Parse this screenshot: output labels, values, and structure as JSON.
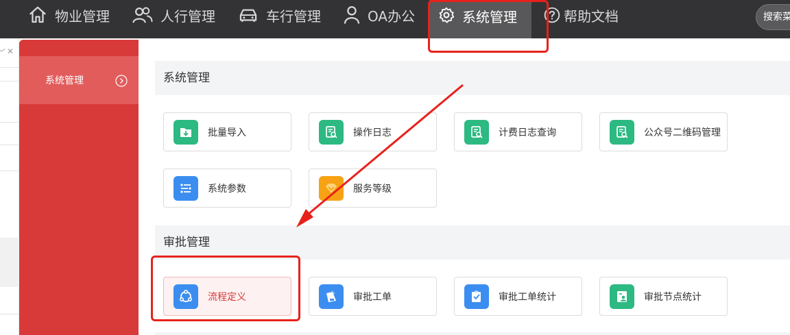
{
  "topnav": {
    "items": [
      {
        "label": "物业管理",
        "icon": "home-icon"
      },
      {
        "label": "人行管理",
        "icon": "people-icon"
      },
      {
        "label": "车行管理",
        "icon": "car-icon"
      },
      {
        "label": "OA办公",
        "icon": "person-icon"
      },
      {
        "label": "系统管理",
        "icon": "gear-icon",
        "active": true
      },
      {
        "label": "帮助文档",
        "icon": "help-icon"
      }
    ],
    "search_text": "搜索菜"
  },
  "strip": {
    "chevron": "﹀",
    "close": "✕"
  },
  "sidebar": {
    "item_label": "系统管理"
  },
  "sections": [
    {
      "title": "系统管理",
      "cards": [
        {
          "label": "批量导入",
          "icon": "folder-download-icon",
          "color": "#2cb982"
        },
        {
          "label": "操作日志",
          "icon": "log-search-icon",
          "color": "#2cb982"
        },
        {
          "label": "计费日志查询",
          "icon": "log-search-icon",
          "color": "#2cb982"
        },
        {
          "label": "公众号二维码管理",
          "icon": "log-search-icon",
          "color": "#2cb982"
        },
        {
          "label": "系统参数",
          "icon": "list-settings-icon",
          "color": "#3b8ef0"
        },
        {
          "label": "服务等级",
          "icon": "diamond-icon",
          "color": "#f7a214"
        }
      ]
    },
    {
      "title": "审批管理",
      "cards": [
        {
          "label": "流程定义",
          "icon": "flow-icon",
          "color": "#3b8ef0",
          "selected": true
        },
        {
          "label": "审批工单",
          "icon": "approval-doc-icon",
          "color": "#3b8ef0"
        },
        {
          "label": "审批工单统计",
          "icon": "clipboard-check-icon",
          "color": "#3b8ef0"
        },
        {
          "label": "审批节点统计",
          "icon": "node-stat-icon",
          "color": "#2cb982"
        }
      ]
    }
  ]
}
